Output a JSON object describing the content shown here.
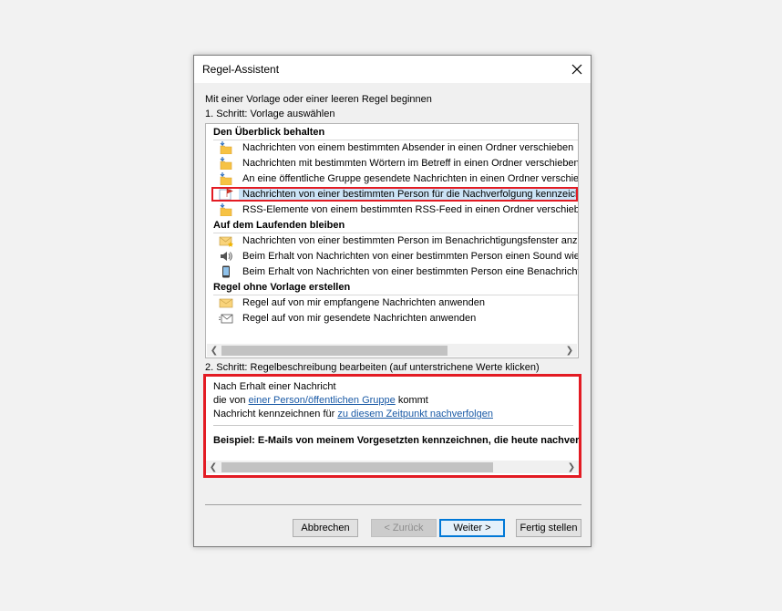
{
  "dialog": {
    "title": "Regel-Assistent",
    "intro": "Mit einer Vorlage oder einer leeren Regel beginnen",
    "step1_label": "1. Schritt: Vorlage auswählen",
    "step2_label": "2. Schritt: Regelbeschreibung bearbeiten (auf unterstrichene Werte klicken)"
  },
  "groups": [
    {
      "title": "Den Überblick behalten",
      "items": [
        {
          "label": "Nachrichten von einem bestimmten Absender in einen Ordner verschieben",
          "icon": "move-to-folder-icon"
        },
        {
          "label": "Nachrichten mit bestimmten Wörtern im Betreff in einen Ordner verschieben",
          "icon": "move-to-folder-icon"
        },
        {
          "label": "An eine öffentliche Gruppe gesendete Nachrichten in einen Ordner verschieben",
          "icon": "move-to-folder-icon"
        },
        {
          "label": "Nachrichten von einer bestimmten Person für die Nachverfolgung kennzeichnen",
          "icon": "flag-icon",
          "selected": true
        },
        {
          "label": "RSS-Elemente von einem bestimmten RSS-Feed in einen Ordner verschieben",
          "icon": "move-to-folder-icon"
        }
      ]
    },
    {
      "title": "Auf dem Laufenden bleiben",
      "items": [
        {
          "label": "Nachrichten von einer bestimmten Person im Benachrichtigungsfenster anzeigen",
          "icon": "envelope-star-icon"
        },
        {
          "label": "Beim Erhalt von Nachrichten von einer bestimmten Person einen Sound wiedergeben",
          "icon": "speaker-icon"
        },
        {
          "label": "Beim Erhalt von Nachrichten von einer bestimmten Person eine Benachrichtigung an das Mobilgerät senden",
          "icon": "mobile-phone-icon"
        }
      ]
    },
    {
      "title": "Regel ohne Vorlage erstellen",
      "items": [
        {
          "label": "Regel auf von mir empfangene Nachrichten anwenden",
          "icon": "envelope-icon"
        },
        {
          "label": "Regel auf von mir gesendete Nachrichten anwenden",
          "icon": "sent-envelope-icon"
        }
      ]
    }
  ],
  "description": {
    "line1": "Nach Erhalt einer Nachricht",
    "line2_prefix": "die von ",
    "line2_link": "einer Person/öffentlichen Gruppe",
    "line2_suffix": " kommt",
    "line3_prefix": "Nachricht kennzeichnen für ",
    "line3_link": "zu diesem Zeitpunkt nachverfolgen",
    "example": "Beispiel: E-Mails von meinem Vorgesetzten kennzeichnen, die heute nachverfolgt werden müssen"
  },
  "buttons": {
    "cancel": "Abbrechen",
    "back": "< Zurück",
    "next": "Weiter >",
    "finish": "Fertig stellen"
  },
  "colors": {
    "highlight": "#e31b23",
    "selection": "#cce4f7",
    "link": "#1a5aa6"
  }
}
